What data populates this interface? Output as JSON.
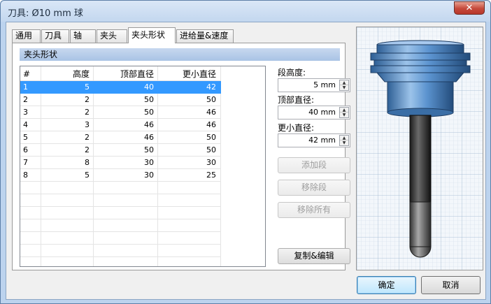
{
  "window": {
    "title": "刀具: Ø10 mm 球",
    "close_label": "✕"
  },
  "tabs": [
    {
      "label": "通用"
    },
    {
      "label": "刀具"
    },
    {
      "label": "轴"
    },
    {
      "label": "夹头"
    },
    {
      "label": "夹头形状"
    },
    {
      "label": "进给量&速度"
    }
  ],
  "active_tab": "夹头形状",
  "group": {
    "title": "夹头形状"
  },
  "table": {
    "headers": [
      "#",
      "高度",
      "顶部直径",
      "更小直径"
    ],
    "rows": [
      [
        "1",
        "5",
        "40",
        "42"
      ],
      [
        "2",
        "2",
        "50",
        "50"
      ],
      [
        "3",
        "2",
        "50",
        "46"
      ],
      [
        "4",
        "3",
        "46",
        "46"
      ],
      [
        "5",
        "2",
        "46",
        "50"
      ],
      [
        "6",
        "2",
        "50",
        "50"
      ],
      [
        "7",
        "8",
        "30",
        "30"
      ],
      [
        "8",
        "5",
        "30",
        "25"
      ]
    ],
    "selected_row": 1
  },
  "fields": {
    "segment_height": {
      "label": "段高度:",
      "value": "5 mm"
    },
    "top_diameter": {
      "label": "顶部直径:",
      "value": "40 mm"
    },
    "lower_diameter": {
      "label": "更小直径:",
      "value": "42 mm"
    }
  },
  "buttons": {
    "add_segment": "添加段",
    "remove_segment": "移除段",
    "remove_all": "移除所有",
    "copy_edit": "复制&编辑",
    "ok": "确定",
    "cancel": "取消"
  },
  "icons": {
    "close": "close-icon",
    "spin_up": "spin-up-icon",
    "spin_down": "spin-down-icon"
  },
  "colors": {
    "selection": "#3399ff",
    "group_header": "#b3cbe9",
    "holder_blue": "#4d87c4",
    "grid": "#b9c9dc"
  }
}
